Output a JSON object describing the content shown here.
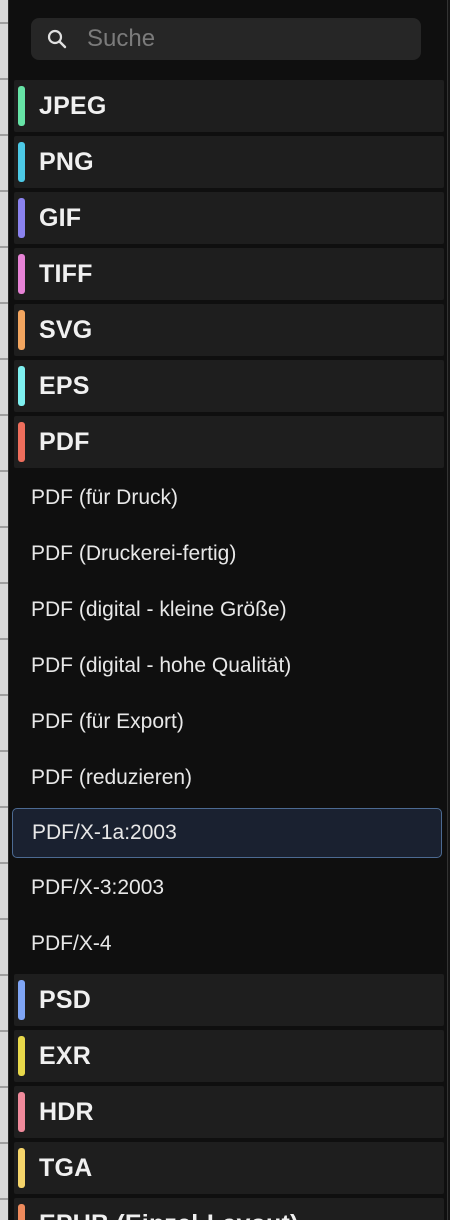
{
  "search": {
    "placeholder": "Suche"
  },
  "categories": [
    {
      "label": "JPEG",
      "color": "#66e3a6"
    },
    {
      "label": "PNG",
      "color": "#4cc9e6"
    },
    {
      "label": "GIF",
      "color": "#8a82ee"
    },
    {
      "label": "TIFF",
      "color": "#e783d6"
    },
    {
      "label": "SVG",
      "color": "#f2a55f"
    },
    {
      "label": "EPS",
      "color": "#7ef0f0"
    },
    {
      "label": "PDF",
      "color": "#ee6e5c"
    }
  ],
  "pdf_items": [
    "PDF (für Druck)",
    "PDF (Druckerei-fertig)",
    "PDF (digital - kleine Größe)",
    "PDF (digital - hohe Qualität)",
    "PDF (für Export)",
    "PDF (reduzieren)",
    "PDF/X-1a:2003",
    "PDF/X-3:2003",
    "PDF/X-4"
  ],
  "selected_item": "PDF/X-1a:2003",
  "categories_after": [
    {
      "label": "PSD",
      "color": "#7fa5f5"
    },
    {
      "label": "EXR",
      "color": "#e8d84a"
    },
    {
      "label": "HDR",
      "color": "#f08a9b"
    },
    {
      "label": "TGA",
      "color": "#f5d46a"
    },
    {
      "label": "EPUB (Einzel-Layout)",
      "color": "#ee8a5c"
    }
  ]
}
